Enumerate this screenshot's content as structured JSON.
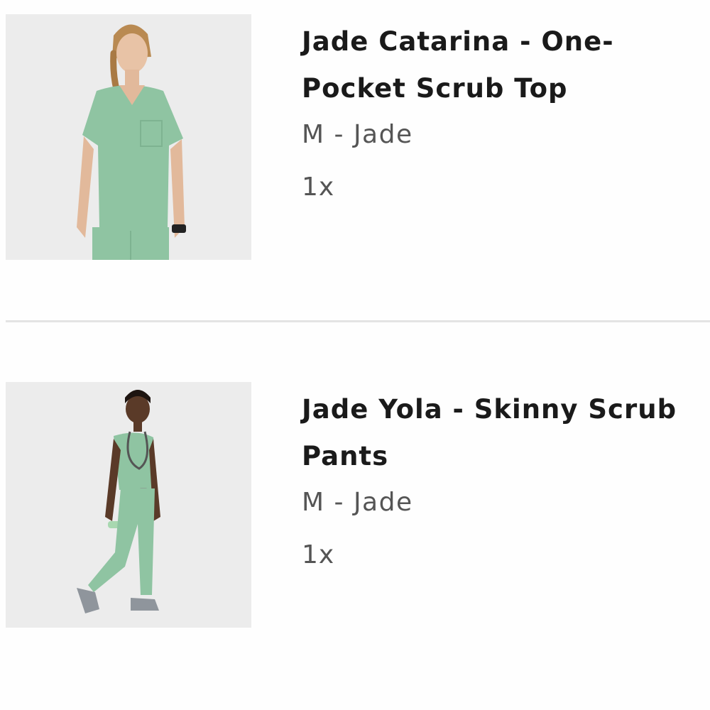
{
  "cart": {
    "items": [
      {
        "title": "Jade Catarina - One-\nPocket Scrub Top",
        "variant": "M - Jade",
        "quantity": "1x",
        "image_alt": "woman-in-jade-scrub-top"
      },
      {
        "title": "Jade Yola - Skinny Scrub\nPants",
        "variant": "M - Jade",
        "quantity": "1x",
        "image_alt": "woman-in-jade-scrub-pants"
      }
    ]
  },
  "colors": {
    "scrub_jade": "#8fc4a2",
    "image_background": "#ececec",
    "title_text": "#1a1a1a",
    "meta_text": "#555555",
    "divider": "#e4e4e4"
  }
}
